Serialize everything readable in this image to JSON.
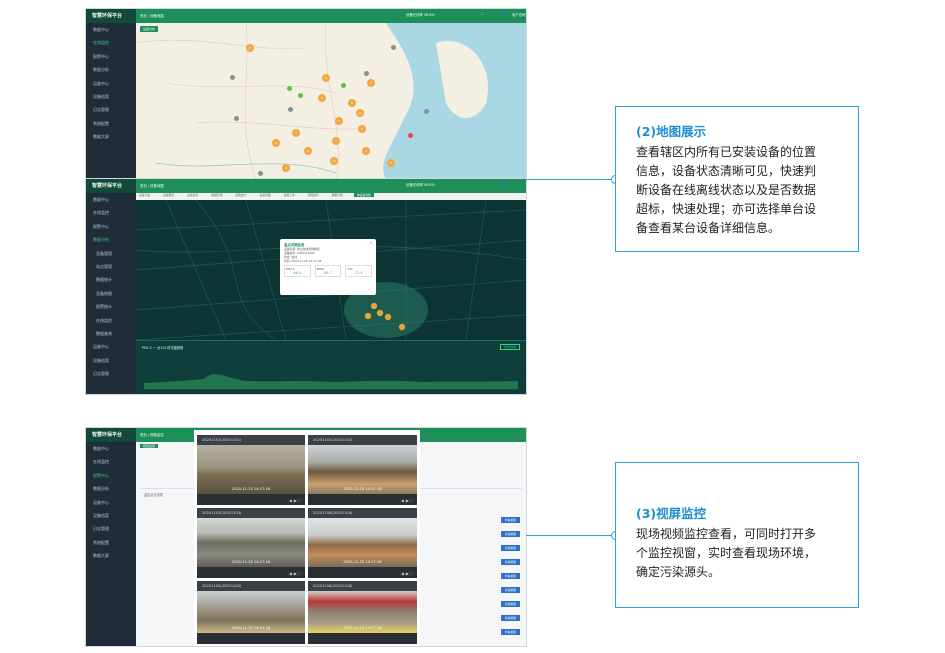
{
  "app": {
    "title": "智慧环保平台",
    "nav": [
      "数据中心",
      "在线监控",
      "报警中心",
      "数据分析",
      "运维中心",
      "设备档案",
      "日志管理",
      "系统配置",
      "数据大屏"
    ],
    "subnav": [
      "设备管理",
      "站点管理",
      "数据统计",
      "设备地图",
      "报警统计",
      "在线监控",
      "数据查询"
    ]
  },
  "map_screen": {
    "crumb": "首页 / 设备地图",
    "tag": "设备分布",
    "status_right": "设备在线率 98.6%",
    "user": "用户名称"
  },
  "grid_screen": {
    "tabs": [
      "设备列表",
      "设备概况",
      "设备监控",
      "数据查询",
      "报警统计",
      "设备地图",
      "运维工单",
      "视频监控",
      "数据分析",
      "单设备详情"
    ],
    "active_tab": "单设备详情",
    "popup": {
      "title": "监点详细信息",
      "lines": [
        "设备名称: 扬尘在线监测终端",
        "设备编号: 2020110109",
        "状态: 在线",
        "时间: 2020-11-25 14:17:18"
      ],
      "metrics": [
        {
          "label": "PM2.5",
          "value": "46.3"
        },
        {
          "label": "PM10",
          "value": "58.7"
        },
        {
          "label": "TSP",
          "value": "72.4"
        }
      ]
    },
    "chart_title": "PM2.5 一 近12小时浓度趋势",
    "chart_button": "历史详情"
  },
  "video_screen": {
    "crumb": "首页 / 视频监控",
    "tab": "视频监控",
    "panel_title": "监控点位列表",
    "cameras": [
      "20201101(20201101)",
      "20201102(20201102)",
      "20201103(20201103)",
      "20201104(20201104)",
      "20201105(20201105)",
      "20201106(20201106)"
    ],
    "timestamp": "2020-11-25  14:17:18",
    "row_action": "查看视频"
  },
  "callouts": [
    {
      "heading": "(2)地图展示",
      "lines": [
        "查看辖区内所有已安装设备的位置",
        "信息，设备状态清晰可见，快速判",
        "断设备在线离线状态以及是否数据",
        "超标，快速处理；亦可选择单台设",
        "备查看某台设备详细信息。"
      ]
    },
    {
      "heading": "(3)视屏监控",
      "lines": [
        "现场视频监控查看，可同时打开多",
        "个监控视窗，实时查看现场环境，",
        "确定污染源头。"
      ]
    }
  ],
  "colors": {
    "accent": "#1f8f5a",
    "callout": "#2ba3d9",
    "pin": "#f4a640",
    "offline": "#8b8f93",
    "online": "#5fbf45",
    "alarm": "#e54b4b"
  }
}
